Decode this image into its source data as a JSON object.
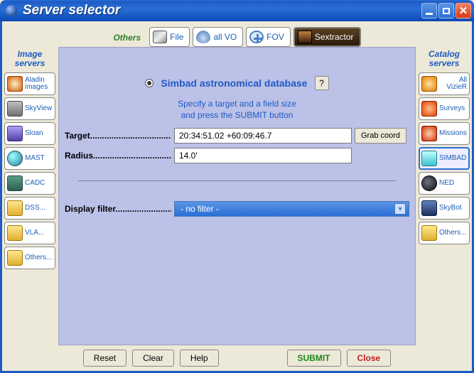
{
  "window": {
    "title": "Server selector"
  },
  "top_tabs": {
    "others_label": "Others",
    "file": "File",
    "allvo": "all VO",
    "fov": "FOV",
    "sextractor": "Sextractor"
  },
  "left": {
    "title": "Image servers",
    "items": [
      {
        "label": "Aladin images"
      },
      {
        "label": "SkyView"
      },
      {
        "label": "Sloan"
      },
      {
        "label": "MAST"
      },
      {
        "label": "CADC"
      },
      {
        "label": "DSS..."
      },
      {
        "label": "VLA..."
      },
      {
        "label": "Others..."
      }
    ]
  },
  "right": {
    "title": "Catalog servers",
    "items": [
      {
        "label": "All VizieR"
      },
      {
        "label": "Surveys"
      },
      {
        "label": "Missions"
      },
      {
        "label": "SIMBAD"
      },
      {
        "label": "NED"
      },
      {
        "label": "SkyBot"
      },
      {
        "label": "Others..."
      }
    ]
  },
  "center": {
    "db_title": "Simbad astronomical database",
    "help": "?",
    "instruct1": "Specify a target and a field size",
    "instruct2": "and press the SUBMIT button",
    "target_label": "Target........................................",
    "target_value": "20:34:51.02 +60:09:46.7",
    "grab_label": "Grab coord",
    "radius_label": "Radius.......................................",
    "radius_value": "14.0'",
    "filter_label": "Display filter...............................",
    "filter_value": "- no filter -"
  },
  "buttons": {
    "reset": "Reset",
    "clear": "Clear",
    "help": "Help",
    "submit": "SUBMIT",
    "close": "Close"
  }
}
